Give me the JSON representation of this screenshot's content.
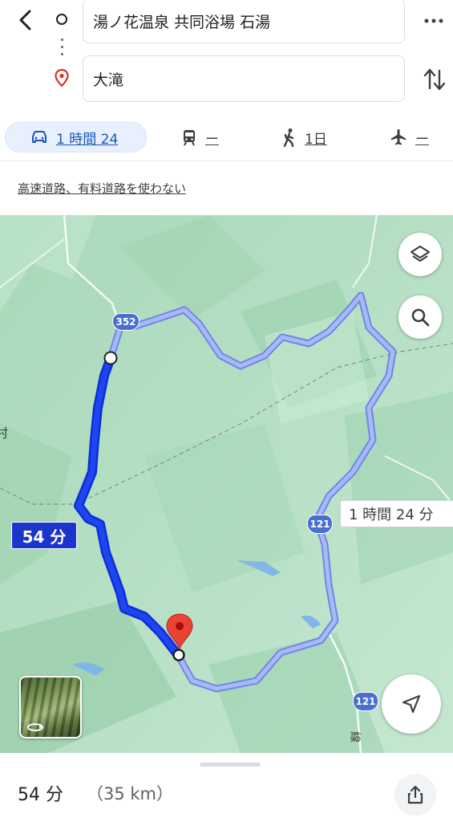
{
  "search": {
    "origin": "湯ノ花温泉 共同浴場 石湯",
    "destination": "大滝"
  },
  "modes": {
    "drive": "1 時間 24",
    "transit": "ー",
    "walk": "1日",
    "flight": "ー"
  },
  "options_link": "高速道路、有料道路を使わない",
  "map": {
    "route_selected_label": "54 分",
    "route_alt_label": "1 時間 24 分",
    "road_352": "352",
    "road_121a": "121",
    "road_121b": "121",
    "edge_left_text": "村",
    "edge_bottom_text": "線",
    "colors": {
      "selected_route": "#1a3de0",
      "alt_route": "#8fa3f0",
      "accent": "#1a56b8"
    }
  },
  "summary": {
    "duration": "54 分",
    "distance": "（35 km）"
  },
  "icons": [
    "back-arrow-icon",
    "origin-circle-icon",
    "destination-pin-icon",
    "more-icon",
    "swap-icon",
    "car-icon",
    "train-icon",
    "walk-icon",
    "plane-icon",
    "layers-icon",
    "search-icon",
    "navigation-icon",
    "share-icon",
    "street-view-icon"
  ]
}
